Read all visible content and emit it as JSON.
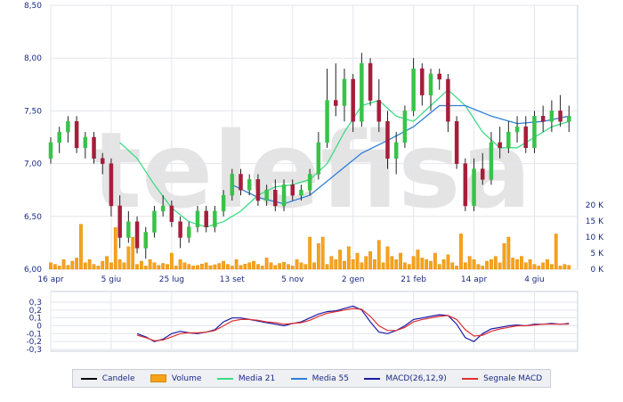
{
  "watermark": "telefisa",
  "legend": [
    {
      "label": "Candele",
      "color": "#000000",
      "kind": "line"
    },
    {
      "label": "Volume",
      "color": "#f7a21b",
      "kind": "box"
    },
    {
      "label": "Media 21",
      "color": "#3ddc84",
      "kind": "line"
    },
    {
      "label": "Media 55",
      "color": "#2f7fd8",
      "kind": "line"
    },
    {
      "label": "MACD(26,12,9)",
      "color": "#1a1aa8",
      "kind": "line"
    },
    {
      "label": "Segnale MACD",
      "color": "#e03030",
      "kind": "line"
    }
  ],
  "chart_data": [
    {
      "type": "candlestick",
      "title": "",
      "ylim": [
        6.0,
        8.5
      ],
      "y_ticks": [
        "8,50",
        "8,00",
        "7,50",
        "7,00",
        "6,50",
        "6,00"
      ],
      "x_ticks": [
        "16 apr",
        "5 giu",
        "25 lug",
        "13 set",
        "5 nov",
        "2 gen",
        "21 feb",
        "14 apr",
        "4 giu"
      ],
      "x_range": [
        0,
        61
      ],
      "x_tick_positions": [
        0,
        7,
        14,
        21,
        28,
        35,
        42,
        49,
        56
      ],
      "colors": {
        "up": "#39c24a",
        "down": "#a51e3a"
      },
      "candles": [
        [
          0,
          7.05,
          7.25,
          7.0,
          7.2
        ],
        [
          1,
          7.2,
          7.35,
          7.1,
          7.3
        ],
        [
          2,
          7.3,
          7.45,
          7.2,
          7.4
        ],
        [
          3,
          7.4,
          7.45,
          7.1,
          7.15
        ],
        [
          4,
          7.15,
          7.3,
          7.05,
          7.25
        ],
        [
          5,
          7.25,
          7.3,
          7.0,
          7.05
        ],
        [
          6,
          7.05,
          7.1,
          6.9,
          7.0
        ],
        [
          7,
          7.0,
          7.05,
          6.5,
          6.6
        ],
        [
          8,
          6.6,
          6.7,
          6.2,
          6.3
        ],
        [
          9,
          6.3,
          6.55,
          6.25,
          6.45
        ],
        [
          10,
          6.45,
          6.5,
          6.15,
          6.2
        ],
        [
          11,
          6.2,
          6.4,
          6.1,
          6.35
        ],
        [
          12,
          6.35,
          6.6,
          6.3,
          6.55
        ],
        [
          13,
          6.55,
          6.7,
          6.5,
          6.6
        ],
        [
          14,
          6.6,
          6.65,
          6.4,
          6.45
        ],
        [
          15,
          6.45,
          6.5,
          6.2,
          6.3
        ],
        [
          16,
          6.3,
          6.45,
          6.25,
          6.4
        ],
        [
          17,
          6.4,
          6.6,
          6.35,
          6.55
        ],
        [
          18,
          6.55,
          6.6,
          6.35,
          6.4
        ],
        [
          19,
          6.4,
          6.6,
          6.35,
          6.55
        ],
        [
          20,
          6.55,
          6.75,
          6.5,
          6.7
        ],
        [
          21,
          6.7,
          6.95,
          6.65,
          6.9
        ],
        [
          22,
          6.9,
          6.95,
          6.7,
          6.75
        ],
        [
          23,
          6.75,
          6.9,
          6.7,
          6.85
        ],
        [
          24,
          6.85,
          6.9,
          6.6,
          6.65
        ],
        [
          25,
          6.65,
          6.8,
          6.6,
          6.75
        ],
        [
          26,
          6.75,
          6.85,
          6.55,
          6.6
        ],
        [
          27,
          6.6,
          6.85,
          6.55,
          6.8
        ],
        [
          28,
          6.8,
          6.85,
          6.65,
          6.7
        ],
        [
          29,
          6.7,
          6.8,
          6.65,
          6.75
        ],
        [
          30,
          6.75,
          6.95,
          6.7,
          6.9
        ],
        [
          31,
          6.9,
          7.3,
          6.85,
          7.2
        ],
        [
          32,
          7.2,
          7.9,
          7.15,
          7.6
        ],
        [
          33,
          7.6,
          7.95,
          7.45,
          7.55
        ],
        [
          34,
          7.55,
          7.9,
          7.4,
          7.8
        ],
        [
          35,
          7.8,
          7.85,
          7.3,
          7.4
        ],
        [
          36,
          7.4,
          8.05,
          7.35,
          7.95
        ],
        [
          37,
          7.95,
          8.0,
          7.55,
          7.6
        ],
        [
          38,
          7.6,
          7.8,
          7.3,
          7.4
        ],
        [
          39,
          7.4,
          7.5,
          6.95,
          7.05
        ],
        [
          40,
          7.05,
          7.3,
          6.9,
          7.2
        ],
        [
          41,
          7.2,
          7.55,
          7.15,
          7.5
        ],
        [
          42,
          7.5,
          8.0,
          7.45,
          7.9
        ],
        [
          43,
          7.9,
          7.95,
          7.55,
          7.65
        ],
        [
          44,
          7.65,
          7.9,
          7.5,
          7.85
        ],
        [
          45,
          7.85,
          7.9,
          7.7,
          7.8
        ],
        [
          46,
          7.8,
          7.85,
          7.3,
          7.4
        ],
        [
          47,
          7.4,
          7.45,
          6.95,
          7.0
        ],
        [
          48,
          7.0,
          7.05,
          6.55,
          6.6
        ],
        [
          49,
          6.6,
          7.05,
          6.55,
          6.95
        ],
        [
          50,
          6.95,
          7.1,
          6.8,
          6.85
        ],
        [
          51,
          6.85,
          7.3,
          6.8,
          7.2
        ],
        [
          52,
          7.2,
          7.35,
          7.05,
          7.15
        ],
        [
          53,
          7.15,
          7.4,
          7.1,
          7.3
        ],
        [
          54,
          7.3,
          7.45,
          7.2,
          7.35
        ],
        [
          55,
          7.35,
          7.45,
          7.1,
          7.15
        ],
        [
          56,
          7.15,
          7.5,
          7.1,
          7.45
        ],
        [
          57,
          7.45,
          7.55,
          7.3,
          7.4
        ],
        [
          58,
          7.4,
          7.6,
          7.3,
          7.5
        ],
        [
          59,
          7.5,
          7.65,
          7.35,
          7.4
        ],
        [
          60,
          7.4,
          7.55,
          7.3,
          7.45
        ]
      ],
      "series": [
        {
          "name": "Media 21",
          "color": "#3ddc84",
          "x": [
            8,
            10,
            12,
            14,
            16,
            18,
            20,
            22,
            24,
            26,
            28,
            30,
            32,
            34,
            36,
            38,
            40,
            42,
            44,
            46,
            48,
            50,
            52,
            54,
            56,
            58,
            60
          ],
          "values": [
            7.2,
            7.05,
            6.8,
            6.58,
            6.45,
            6.4,
            6.45,
            6.55,
            6.7,
            6.78,
            6.8,
            6.85,
            7.0,
            7.3,
            7.55,
            7.6,
            7.45,
            7.4,
            7.55,
            7.7,
            7.55,
            7.3,
            7.15,
            7.15,
            7.25,
            7.35,
            7.4
          ]
        },
        {
          "name": "Media 55",
          "color": "#2f7fd8",
          "x": [
            21,
            24,
            27,
            30,
            33,
            36,
            39,
            42,
            45,
            48,
            51,
            54,
            57,
            60
          ],
          "values": [
            6.8,
            6.68,
            6.62,
            6.7,
            6.9,
            7.1,
            7.22,
            7.35,
            7.55,
            7.55,
            7.45,
            7.38,
            7.4,
            7.45
          ]
        }
      ]
    },
    {
      "type": "bar",
      "title": "",
      "name": "Volume",
      "ylim": [
        0,
        25000
      ],
      "y_ticks": [
        "20 K",
        "15 K",
        "10 K",
        "5 K",
        "0 K"
      ],
      "color": "#f7a21b",
      "x_range": [
        0,
        61
      ],
      "x": [
        0,
        0.5,
        1,
        1.5,
        2,
        2.5,
        3,
        3.5,
        4,
        4.5,
        5,
        5.5,
        6,
        6.5,
        7,
        7.5,
        8,
        8.5,
        9,
        9.5,
        10,
        10.5,
        11,
        11.5,
        12,
        12.5,
        13,
        13.5,
        14,
        14.5,
        15,
        15.5,
        16,
        16.5,
        17,
        17.5,
        18,
        18.5,
        19,
        19.5,
        20,
        20.5,
        21,
        21.5,
        22,
        22.5,
        23,
        23.5,
        24,
        24.5,
        25,
        25.5,
        26,
        26.5,
        27,
        27.5,
        28,
        28.5,
        29,
        29.5,
        30,
        30.5,
        31,
        31.5,
        32,
        32.5,
        33,
        33.5,
        34,
        34.5,
        35,
        35.5,
        36,
        36.5,
        37,
        37.5,
        38,
        38.5,
        39,
        39.5,
        40,
        40.5,
        41,
        41.5,
        42,
        42.5,
        43,
        43.5,
        44,
        44.5,
        45,
        45.5,
        46,
        46.5,
        47,
        47.5,
        48,
        48.5,
        49,
        49.5,
        50,
        50.5,
        51,
        51.5,
        52,
        52.5,
        53,
        53.5,
        54,
        54.5,
        55,
        55.5,
        56,
        56.5,
        57,
        57.5,
        58,
        58.5,
        59,
        59.5,
        60
      ],
      "values": [
        2000,
        1500,
        1000,
        3000,
        1200,
        2500,
        3500,
        14000,
        2000,
        3000,
        1500,
        1000,
        2500,
        4000,
        2000,
        13000,
        3000,
        2000,
        7000,
        10000,
        1500,
        2500,
        1000,
        3000,
        2000,
        1200,
        1800,
        1500,
        5000,
        1000,
        3000,
        2000,
        1500,
        1000,
        1200,
        1600,
        2000,
        1100,
        1400,
        1800,
        2500,
        1500,
        1000,
        3000,
        1200,
        1600,
        2000,
        2500,
        1500,
        1000,
        3500,
        2000,
        1200,
        1800,
        2200,
        1500,
        1000,
        3000,
        2000,
        1500,
        10000,
        2000,
        8000,
        10000,
        1500,
        4000,
        3000,
        6000,
        2500,
        7000,
        3000,
        5000,
        2000,
        4000,
        5500,
        3000,
        9000,
        2000,
        7000,
        4000,
        3000,
        5000,
        2000,
        1500,
        4000,
        6000,
        3500,
        3000,
        2500,
        5000,
        1500,
        3000,
        4500,
        2000,
        1000,
        11000,
        2000,
        4000,
        3000,
        1500,
        1000,
        2500,
        3000,
        4000,
        2000,
        8000,
        10000,
        3500,
        3000,
        4000,
        2000,
        3000,
        1500,
        1000,
        2000,
        3000,
        1500,
        11000,
        1000,
        1500,
        1200
      ]
    },
    {
      "type": "line",
      "title": "",
      "ylim": [
        -0.3,
        0.3
      ],
      "y_ticks": [
        "0,3",
        "0,2",
        "0,1",
        "0",
        "-0,1",
        "-0,2",
        "-0,3"
      ],
      "x_range": [
        0,
        61
      ],
      "series": [
        {
          "name": "MACD(26,12,9)",
          "color": "#1a1aa8",
          "x": [
            10,
            11,
            12,
            13,
            14,
            15,
            16,
            17,
            18,
            19,
            20,
            21,
            22,
            23,
            24,
            25,
            26,
            27,
            28,
            29,
            30,
            31,
            32,
            33,
            34,
            35,
            36,
            37,
            38,
            39,
            40,
            41,
            42,
            43,
            44,
            45,
            46,
            47,
            48,
            49,
            50,
            51,
            52,
            53,
            54,
            55,
            56,
            57,
            58,
            59,
            60
          ],
          "values": [
            -0.1,
            -0.14,
            -0.2,
            -0.17,
            -0.1,
            -0.07,
            -0.09,
            -0.1,
            -0.08,
            -0.05,
            0.05,
            0.1,
            0.1,
            0.08,
            0.06,
            0.04,
            0.02,
            0.0,
            0.03,
            0.05,
            0.1,
            0.15,
            0.18,
            0.19,
            0.22,
            0.25,
            0.2,
            0.05,
            -0.08,
            -0.1,
            -0.06,
            0.0,
            0.08,
            0.1,
            0.12,
            0.14,
            0.13,
            0.02,
            -0.15,
            -0.2,
            -0.1,
            -0.04,
            -0.02,
            0.0,
            0.01,
            0.0,
            0.02,
            0.02,
            0.03,
            0.02,
            0.03
          ]
        },
        {
          "name": "Segnale MACD",
          "color": "#e03030",
          "x": [
            10,
            11,
            12,
            13,
            14,
            15,
            16,
            17,
            18,
            19,
            20,
            21,
            22,
            23,
            24,
            25,
            26,
            27,
            28,
            29,
            30,
            31,
            32,
            33,
            34,
            35,
            36,
            37,
            38,
            39,
            40,
            41,
            42,
            43,
            44,
            45,
            46,
            47,
            48,
            49,
            50,
            51,
            52,
            53,
            54,
            55,
            56,
            57,
            58,
            59,
            60
          ],
          "values": [
            -0.12,
            -0.15,
            -0.19,
            -0.18,
            -0.14,
            -0.1,
            -0.09,
            -0.09,
            -0.08,
            -0.06,
            0.0,
            0.06,
            0.08,
            0.08,
            0.07,
            0.05,
            0.04,
            0.02,
            0.03,
            0.04,
            0.07,
            0.12,
            0.16,
            0.18,
            0.2,
            0.22,
            0.21,
            0.12,
            0.0,
            -0.06,
            -0.06,
            -0.02,
            0.05,
            0.08,
            0.1,
            0.12,
            0.13,
            0.08,
            -0.05,
            -0.13,
            -0.12,
            -0.07,
            -0.04,
            -0.02,
            0.0,
            0.0,
            0.01,
            0.02,
            0.02,
            0.02,
            0.02
          ]
        }
      ]
    }
  ]
}
